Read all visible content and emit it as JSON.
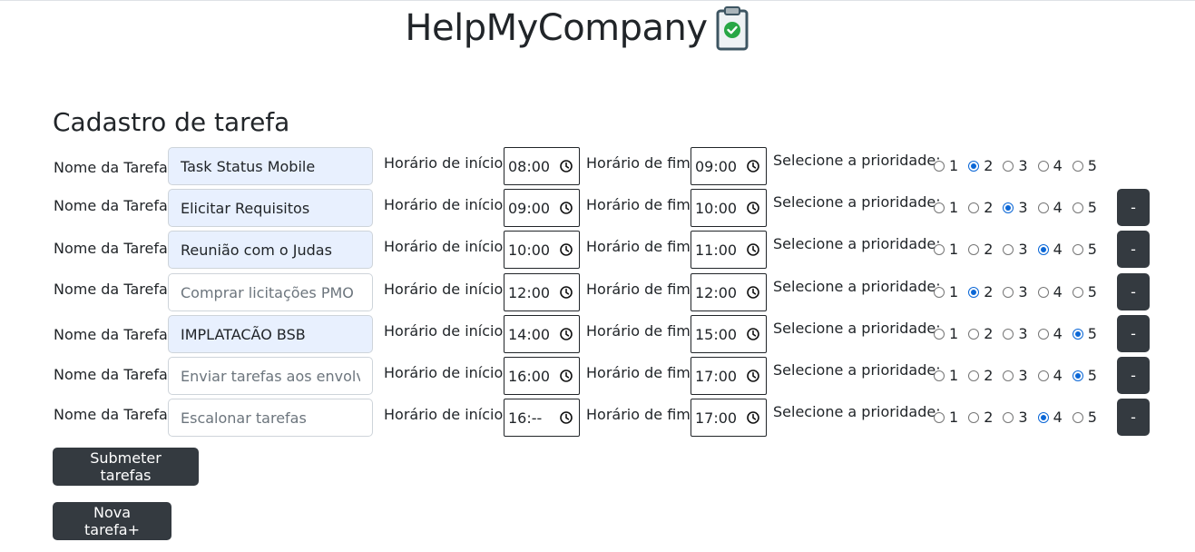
{
  "app": {
    "title": "HelpMyCompany",
    "logo_icon": "clipboard-check-icon"
  },
  "form": {
    "title": "Cadastro de tarefa",
    "name_label": "Nome da Tarefa:",
    "start_label": "Horário de início:",
    "end_label": "Horário de fim:",
    "priority_label": "Selecione a prioridade:",
    "priority_options": [
      "1",
      "2",
      "3",
      "4",
      "5"
    ],
    "remove_label": "-",
    "tasks": [
      {
        "name": "Task Status Mobile",
        "placeholder": "",
        "start": "08:00",
        "end": "09:00",
        "priority": "2",
        "removable": false
      },
      {
        "name": "Elicitar Requisitos",
        "placeholder": "",
        "start": "09:00",
        "end": "10:00",
        "priority": "3",
        "removable": true
      },
      {
        "name": "Reunião com o Judas",
        "placeholder": "",
        "start": "10:00",
        "end": "11:00",
        "priority": "4",
        "removable": true
      },
      {
        "name": "",
        "placeholder": "Comprar licitações PMO",
        "start": "12:00",
        "end": "12:00",
        "priority": "2",
        "removable": true
      },
      {
        "name": "IMPLATACÃO BSB",
        "placeholder": "",
        "start": "14:00",
        "end": "15:00",
        "priority": "5",
        "removable": true
      },
      {
        "name": "",
        "placeholder": "Enviar tarefas aos envolvidos",
        "start": "16:00",
        "end": "17:00",
        "priority": "5",
        "removable": true
      },
      {
        "name": "",
        "placeholder": "Escalonar tarefas",
        "start": "16:--",
        "end": "17:00",
        "priority": "4",
        "removable": true
      }
    ],
    "submit_label": "Submeter tarefas",
    "new_task_label": "Nova tarefa+"
  },
  "colors": {
    "accent": "#0b67d6",
    "button_dark": "#343a40",
    "autofill_bg": "#e8f0fe",
    "logo_check": "#28a745"
  }
}
